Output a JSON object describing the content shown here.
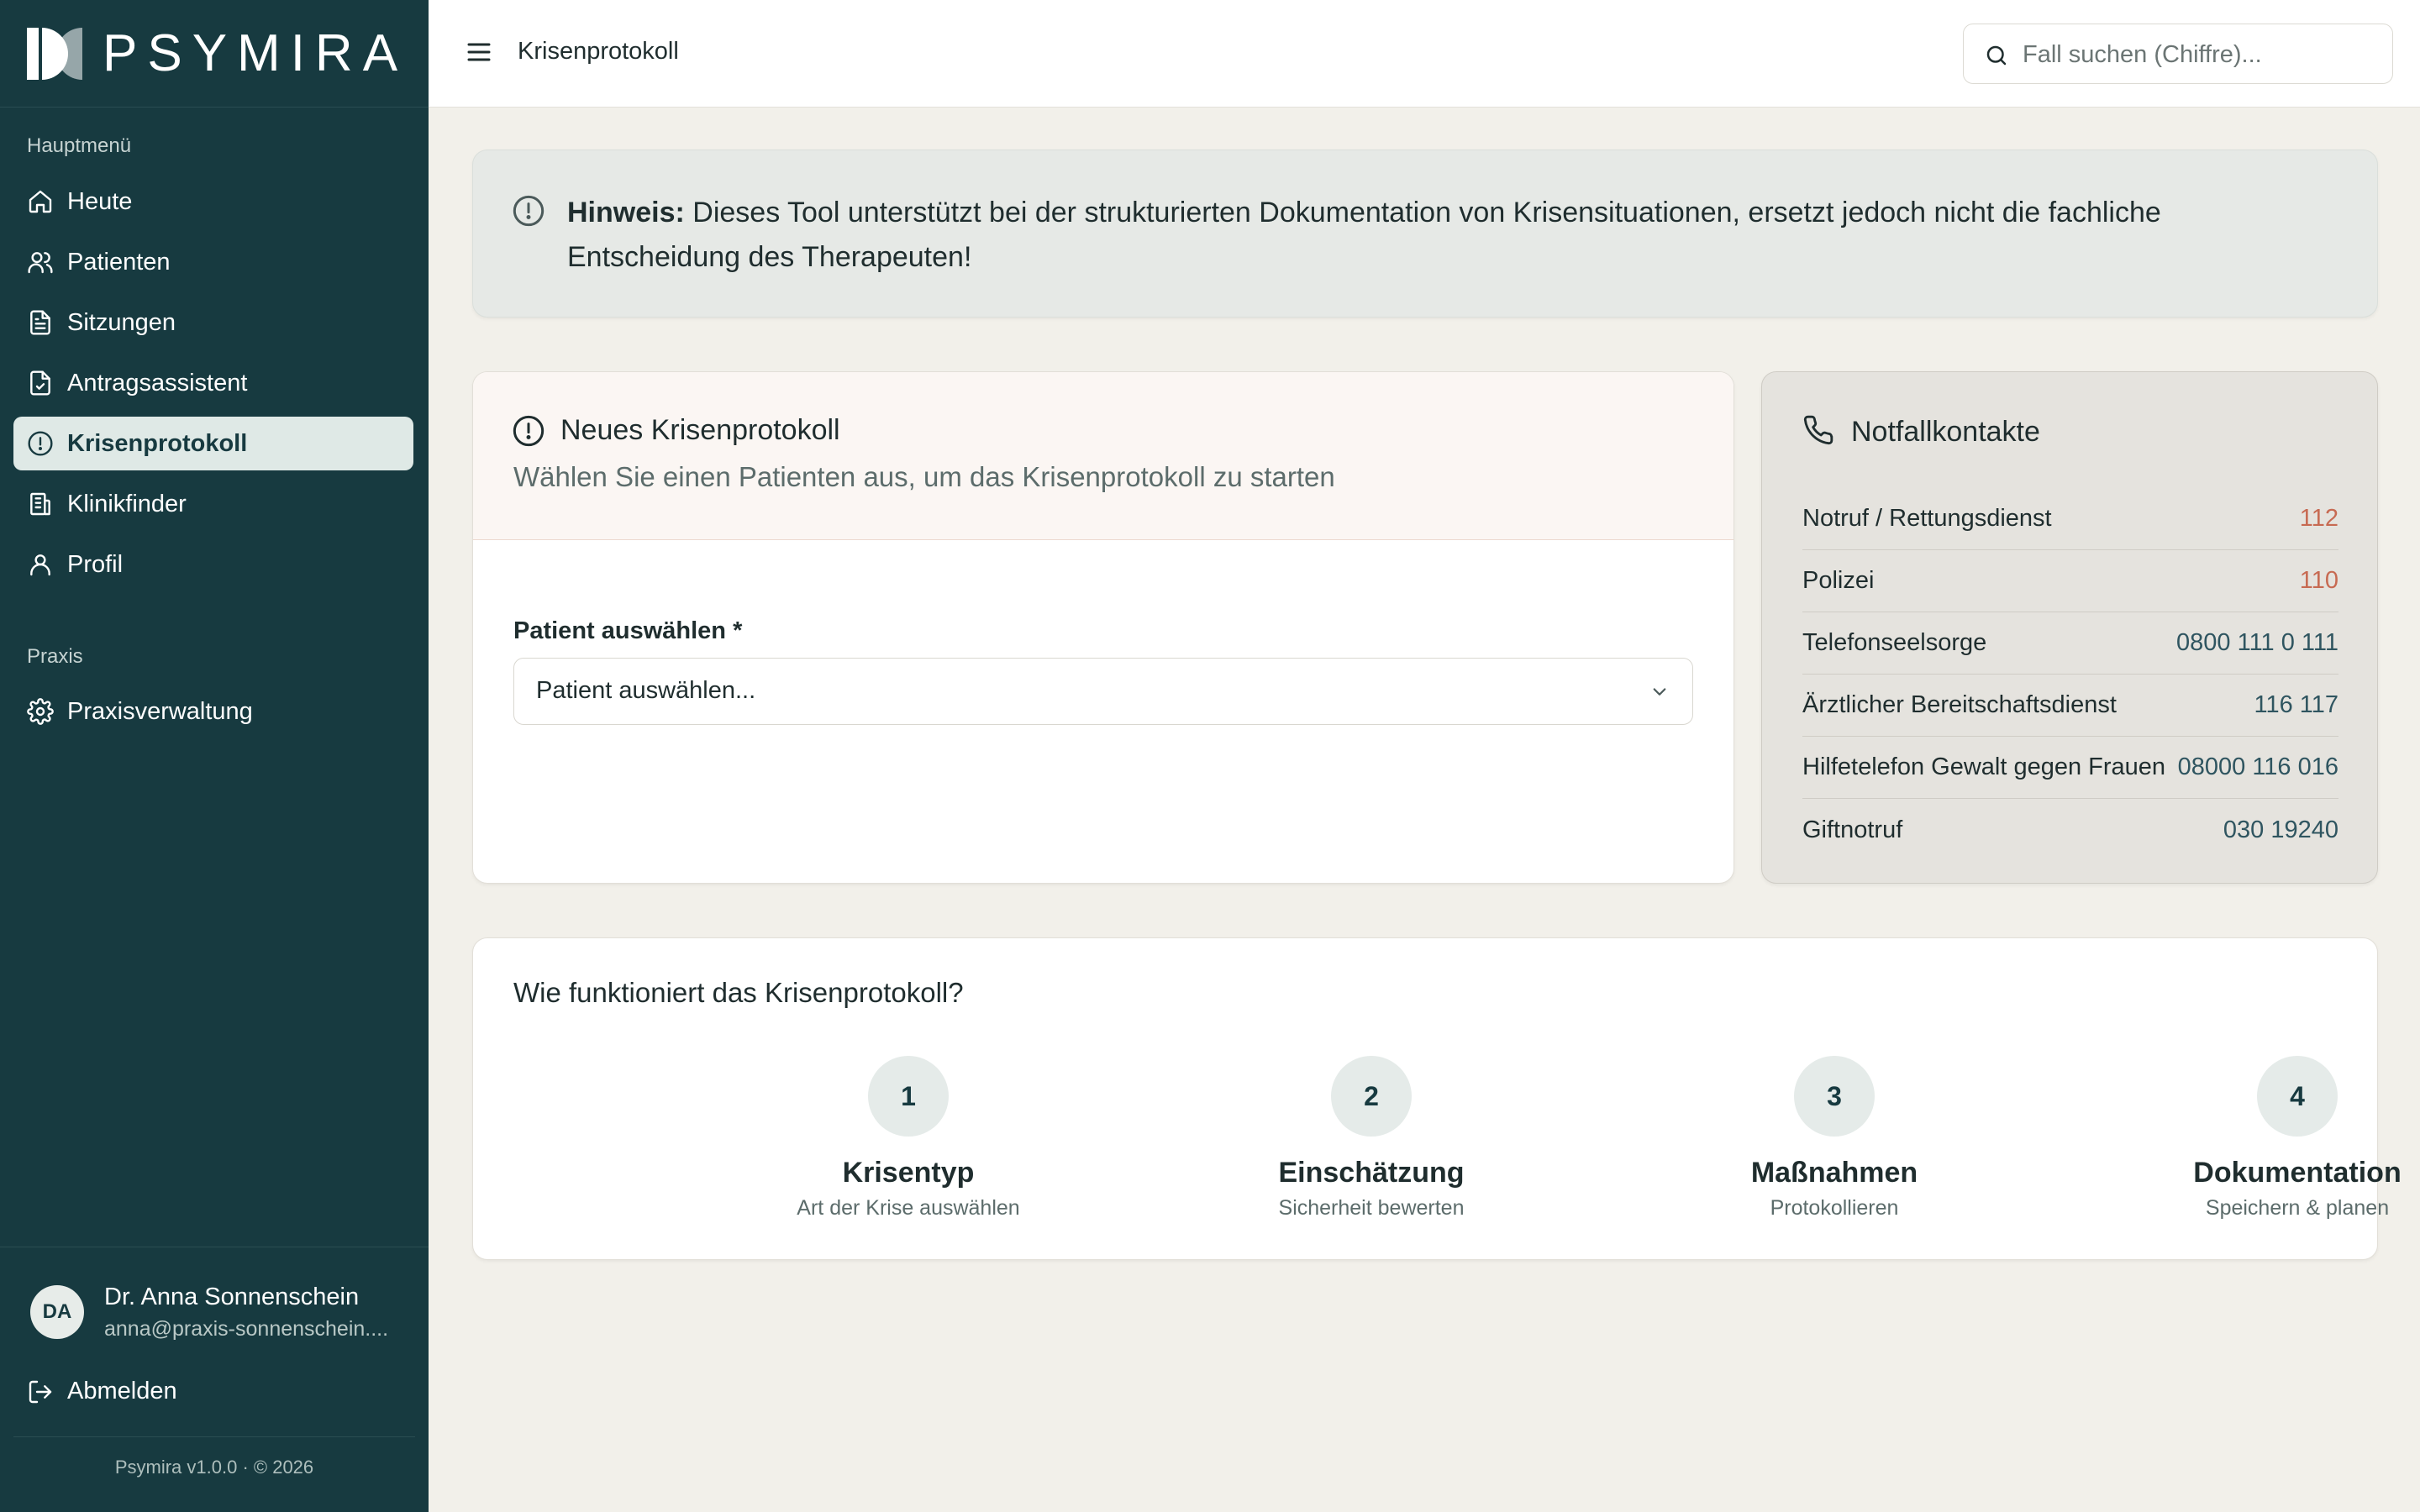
{
  "brand": {
    "name": "PSYMIRA"
  },
  "header": {
    "title": "Krisenprotokoll",
    "search_placeholder": "Fall suchen (Chiffre)..."
  },
  "sidebar": {
    "section_main": "Hauptmenü",
    "items": [
      {
        "label": "Heute",
        "icon": "home-icon"
      },
      {
        "label": "Patienten",
        "icon": "users-icon"
      },
      {
        "label": "Sitzungen",
        "icon": "document-icon"
      },
      {
        "label": "Antragsassistent",
        "icon": "file-check-icon"
      },
      {
        "label": "Krisenprotokoll",
        "icon": "alert-circle-icon",
        "active": true
      },
      {
        "label": "Klinikfinder",
        "icon": "building-icon"
      },
      {
        "label": "Profil",
        "icon": "user-icon"
      }
    ],
    "section_practice": "Praxis",
    "practice_items": [
      {
        "label": "Praxisverwaltung",
        "icon": "gear-icon"
      }
    ],
    "user": {
      "initials": "DA",
      "name": "Dr. Anna Sonnenschein",
      "email": "anna@praxis-sonnenschein...."
    },
    "logout_label": "Abmelden",
    "version": "Psymira v1.0.0 · © 2026"
  },
  "notice": {
    "label": "Hinweis:",
    "text": "Dieses Tool unterstützt bei der strukturierten Dokumentation von Krisensituationen, ersetzt jedoch nicht die fachliche Entscheidung des Therapeuten!"
  },
  "crisis": {
    "title": "Neues Krisenprotokoll",
    "subtitle": "Wählen Sie einen Patienten aus, um das Krisenprotokoll zu starten",
    "field_label": "Patient auswählen *",
    "select_value": "Patient auswählen..."
  },
  "contacts": {
    "title": "Notfallkontakte",
    "items": [
      {
        "name": "Notruf / Rettungsdienst",
        "number": "112",
        "highlight": true
      },
      {
        "name": "Polizei",
        "number": "110",
        "highlight": true
      },
      {
        "name": "Telefonseelsorge",
        "number": "0800 111 0 111"
      },
      {
        "name": "Ärztlicher Bereitschaftsdienst",
        "number": "116 117"
      },
      {
        "name": "Hilfetelefon Gewalt gegen Frauen",
        "number": "08000 116 016"
      },
      {
        "name": "Giftnotruf",
        "number": "030 19240"
      }
    ]
  },
  "how": {
    "title": "Wie funktioniert das Krisenprotokoll?",
    "steps": [
      {
        "number": "1",
        "title": "Krisentyp",
        "subtitle": "Art der Krise auswählen"
      },
      {
        "number": "2",
        "title": "Einschätzung",
        "subtitle": "Sicherheit bewerten"
      },
      {
        "number": "3",
        "title": "Maßnahmen",
        "subtitle": "Protokollieren"
      },
      {
        "number": "4",
        "title": "Dokumentation",
        "subtitle": "Speichern & planen"
      }
    ]
  },
  "colors": {
    "sidebar_bg": "#173a40",
    "page_bg": "#f2f0ea",
    "emergency_red": "#c76a52",
    "phone_teal": "#2f5560"
  }
}
